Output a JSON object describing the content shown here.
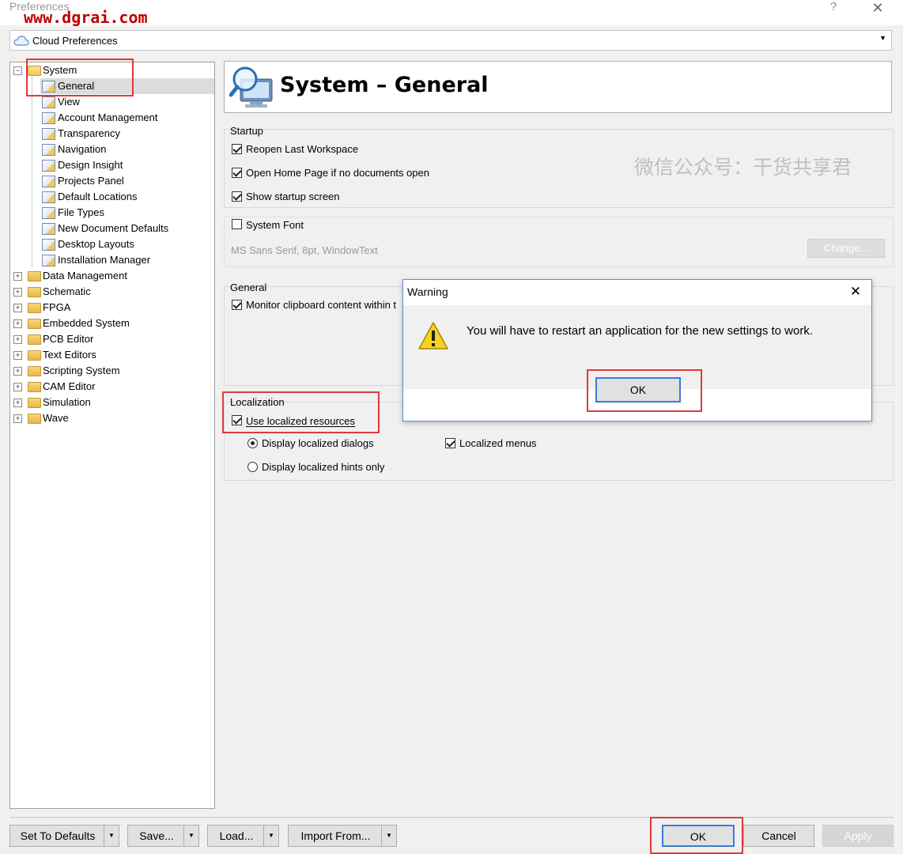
{
  "window": {
    "title": "Preferences",
    "help": "?",
    "close": "✕"
  },
  "watermark_url": "www.dgrai.com",
  "watermark_cn": "微信公众号：干货共享君",
  "cloud": {
    "label": "Cloud Preferences",
    "arrow": "▼",
    "icon": "cloud-icon"
  },
  "tree": {
    "system": "System",
    "children": [
      "General",
      "View",
      "Account Management",
      "Transparency",
      "Navigation",
      "Design Insight",
      "Projects Panel",
      "Default Locations",
      "File Types",
      "New Document Defaults",
      "Desktop Layouts",
      "Installation Manager"
    ],
    "roots": [
      "Data Management",
      "Schematic",
      "FPGA",
      "Embedded System",
      "PCB Editor",
      "Text Editors",
      "Scripting System",
      "CAM Editor",
      "Simulation",
      "Wave"
    ],
    "expanded_sign": "−",
    "collapsed_sign": "+"
  },
  "header": {
    "title": "System – General",
    "icon": "monitor-magnifier-icon"
  },
  "startup": {
    "title": "Startup",
    "options": [
      {
        "label": "Reopen Last Workspace",
        "checked": true
      },
      {
        "label": "Open Home Page if no documents open",
        "checked": true
      },
      {
        "label": "Show startup screen",
        "checked": true
      }
    ]
  },
  "system_font": {
    "label": "System Font",
    "checked": false,
    "value": "MS Sans Serif, 8pt, WindowText",
    "change": "Change..."
  },
  "general": {
    "title": "General",
    "monitor_label": "Monitor clipboard content within t",
    "checked": true
  },
  "localization": {
    "title": "Localization",
    "use_label": "Use localized resources",
    "use_checked": true,
    "dialogs_label": "Display localized dialogs",
    "hints_label": "Display localized hints only",
    "menus_label": "Localized menus",
    "menus_checked": true,
    "selected_radio": "dialogs"
  },
  "dialog": {
    "title": "Warning",
    "close": "✕",
    "message": "You will have to restart an application for the new settings to work.",
    "ok": "OK",
    "icon": "warning-icon"
  },
  "bottom": {
    "set_defaults": "Set To Defaults",
    "save": "Save...",
    "load": "Load...",
    "import": "Import From...",
    "ok": "OK",
    "cancel": "Cancel",
    "apply": "Apply",
    "drop": "▼"
  },
  "colors": {
    "highlight": "#e03a3a",
    "accent": "#3b7ad8",
    "watermark_red": "#c00000"
  }
}
